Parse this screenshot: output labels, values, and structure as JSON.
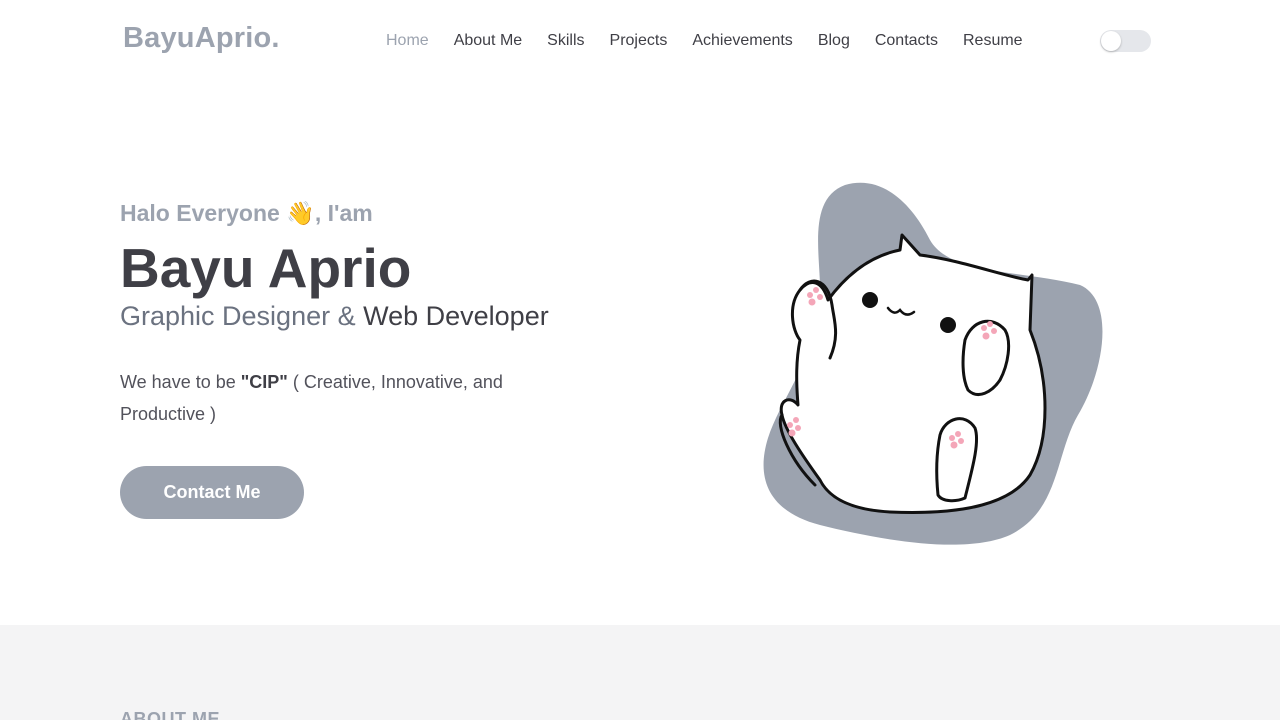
{
  "brand": {
    "name": "BayuAprio."
  },
  "nav": {
    "items": [
      {
        "label": "Home",
        "active": true
      },
      {
        "label": "About Me"
      },
      {
        "label": "Skills"
      },
      {
        "label": "Projects"
      },
      {
        "label": "Achievements"
      },
      {
        "label": "Blog"
      },
      {
        "label": "Contacts"
      },
      {
        "label": "Resume"
      }
    ],
    "theme_toggle": {
      "state": "off"
    }
  },
  "hero": {
    "greeting": "Halo Everyone 👋, I'am",
    "name": "Bayu Aprio",
    "role_part1": "Graphic Designer & ",
    "role_part2": "Web Developer",
    "motto_prefix": "We have to be ",
    "motto_bold": "\"CIP\"",
    "motto_suffix": " ( Creative, Innovative, and Productive )",
    "cta_label": "Contact Me",
    "illustration": "cute-white-cat-illustration"
  },
  "about": {
    "section_label": "ABOUT ME"
  },
  "colors": {
    "accent": "#9ca3af",
    "text": "#3f3f46",
    "blob": "#9ca3af",
    "section_bg": "#f4f4f5"
  }
}
